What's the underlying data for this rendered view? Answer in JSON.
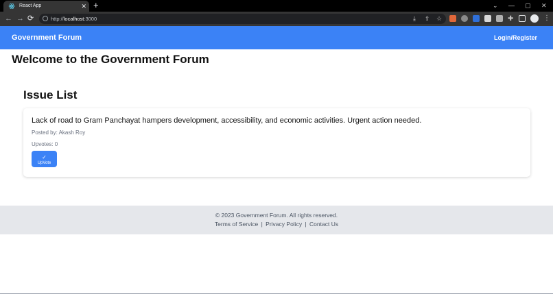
{
  "browser": {
    "tab_title": "React App",
    "close_glyph": "✕",
    "new_tab_glyph": "+",
    "url_scheme": "http://",
    "url_host": "localhost",
    "url_port": ":3000",
    "window_controls": [
      "⌄",
      "—",
      "▢",
      "✕"
    ],
    "icons": [
      "back-icon",
      "forward-icon",
      "reload-icon",
      "info-icon",
      "install-icon",
      "share-icon",
      "bookmark-star-icon",
      "extensions-icon",
      "sidebar-icon",
      "profile-icon",
      "menu-icon"
    ],
    "extension_colors": [
      "#e0673a",
      "#8a8a8a",
      "#2f6fd8",
      "#d8d8d8",
      "#b0b0b0"
    ]
  },
  "navbar": {
    "brand": "Government Forum",
    "login_label": "Login/Register",
    "background": "#3b82f6"
  },
  "main": {
    "welcome": "Welcome to the Government Forum",
    "issue_list_heading": "Issue List",
    "issues": [
      {
        "title": "Lack of road to Gram Panchayat hampers development, accessibility, and economic activities. Urgent action needed.",
        "posted_by_label": "Posted by: ",
        "author": "Akash Roy",
        "upvotes_label": "Upvotes: ",
        "upvotes": "0",
        "upvote_check": "✓",
        "upvote_button": "UpVote"
      }
    ]
  },
  "footer": {
    "copyright": "© 2023 Government Forum. All rights reserved.",
    "links": [
      "Terms of Service",
      "Privacy Policy",
      "Contact Us"
    ],
    "separator": "|",
    "background": "#e5e7eb"
  }
}
